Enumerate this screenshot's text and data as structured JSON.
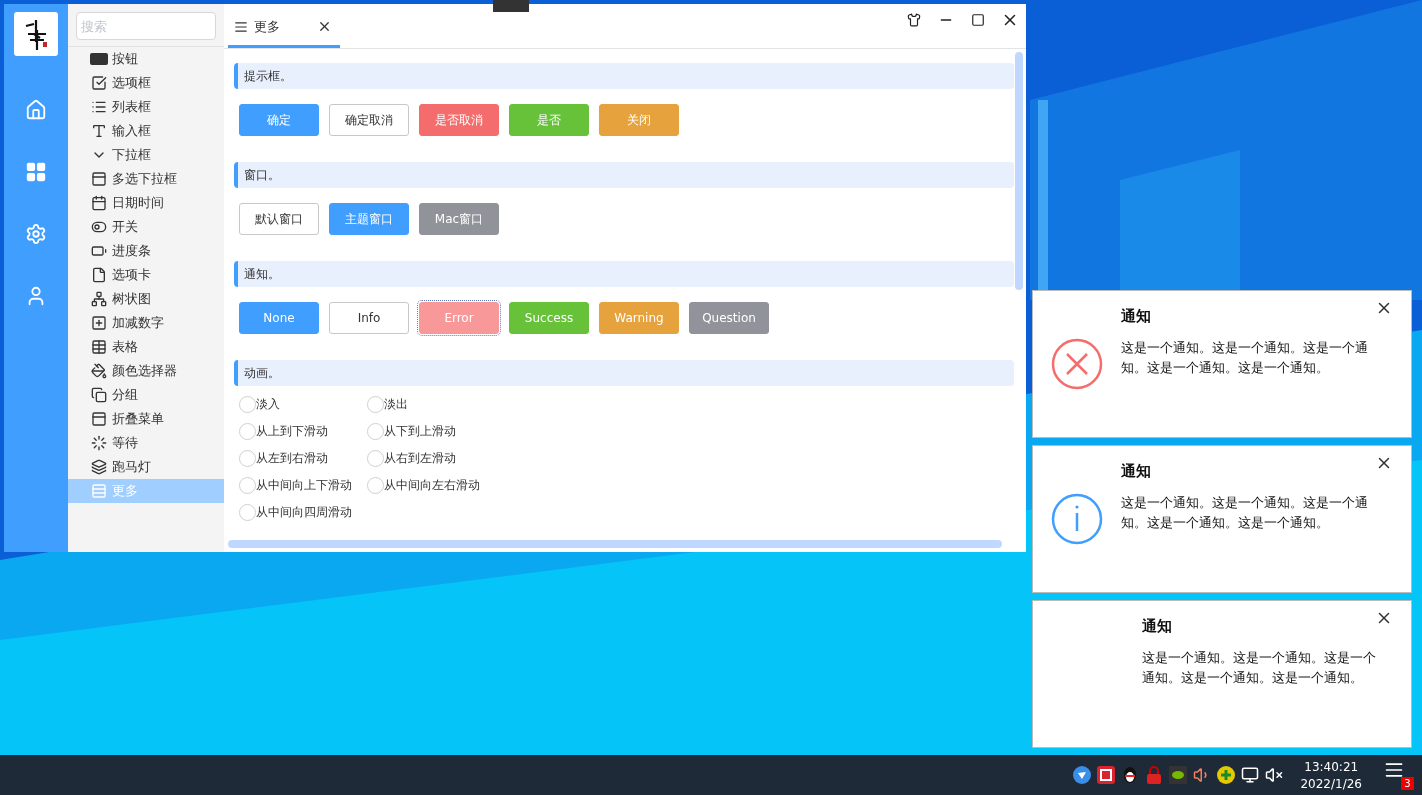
{
  "search": {
    "placeholder": "搜索"
  },
  "nav": [
    {
      "label": "按钮",
      "selected": false
    },
    {
      "label": "选项框",
      "selected": false
    },
    {
      "label": "列表框",
      "selected": false
    },
    {
      "label": "输入框",
      "selected": false
    },
    {
      "label": "下拉框",
      "selected": false
    },
    {
      "label": "多选下拉框",
      "selected": false
    },
    {
      "label": "日期时间",
      "selected": false
    },
    {
      "label": "开关",
      "selected": false
    },
    {
      "label": "进度条",
      "selected": false
    },
    {
      "label": "选项卡",
      "selected": false
    },
    {
      "label": "树状图",
      "selected": false
    },
    {
      "label": "加减数字",
      "selected": false
    },
    {
      "label": "表格",
      "selected": false
    },
    {
      "label": "颜色选择器",
      "selected": false
    },
    {
      "label": "分组",
      "selected": false
    },
    {
      "label": "折叠菜单",
      "selected": false
    },
    {
      "label": "等待",
      "selected": false
    },
    {
      "label": "跑马灯",
      "selected": false
    },
    {
      "label": "更多",
      "selected": true
    }
  ],
  "tabs": [
    {
      "label": "更多",
      "selected": true
    }
  ],
  "sections": [
    {
      "title": "提示框。",
      "kind": "buttons",
      "items": [
        {
          "label": "确定",
          "color": "#409eff",
          "focused": false
        },
        {
          "label": "确定取消",
          "color": "#ffffff",
          "focused": false
        },
        {
          "label": "是否取消",
          "color": "#f56c6c",
          "focused": false
        },
        {
          "label": "是否",
          "color": "#67c23a",
          "focused": false
        },
        {
          "label": "关闭",
          "color": "#e6a23c",
          "focused": false
        }
      ]
    },
    {
      "title": "窗口。",
      "kind": "buttons",
      "items": [
        {
          "label": "默认窗口",
          "color": "#ffffff",
          "focused": false
        },
        {
          "label": "主题窗口",
          "color": "#409eff",
          "focused": false
        },
        {
          "label": "Mac窗口",
          "color": "#909399",
          "focused": false
        }
      ]
    },
    {
      "title": "通知。",
      "kind": "buttons",
      "items": [
        {
          "label": "None",
          "color": "#409eff",
          "focused": false
        },
        {
          "label": "Info",
          "color": "#ffffff",
          "focused": false
        },
        {
          "label": "Error",
          "color": "#f89898",
          "focused": true
        },
        {
          "label": "Success",
          "color": "#67c23a",
          "focused": false
        },
        {
          "label": "Warning",
          "color": "#e6a23c",
          "focused": false
        },
        {
          "label": "Question",
          "color": "#909399",
          "focused": false
        }
      ]
    },
    {
      "title": "动画。",
      "kind": "radios",
      "items": [
        {
          "label": "淡入",
          "checked": false
        },
        {
          "label": "淡出",
          "checked": false
        },
        {
          "label": "从上到下滑动",
          "checked": false
        },
        {
          "label": "从下到上滑动",
          "checked": false
        },
        {
          "label": "从左到右滑动",
          "checked": false
        },
        {
          "label": "从右到左滑动",
          "checked": false
        },
        {
          "label": "从中间向上下滑动",
          "checked": false
        },
        {
          "label": "从中间向左右滑动",
          "checked": false
        },
        {
          "label": "从中间向四周滑动",
          "checked": false
        }
      ]
    }
  ],
  "notifications": [
    {
      "kind": "error",
      "title": "通知",
      "message": "这是一个通知。这是一个通知。这是一个通知。这是一个通知。这是一个通知。"
    },
    {
      "kind": "info",
      "title": "通知",
      "message": "这是一个通知。这是一个通知。这是一个通知。这是一个通知。这是一个通知。"
    },
    {
      "kind": "none",
      "title": "通知",
      "message": "这是一个通知。这是一个通知。这是一个通知。这是一个通知。这是一个通知。"
    }
  ],
  "taskbar": {
    "time": "13:40:21",
    "date": "2022/1/26",
    "badge": "3"
  }
}
